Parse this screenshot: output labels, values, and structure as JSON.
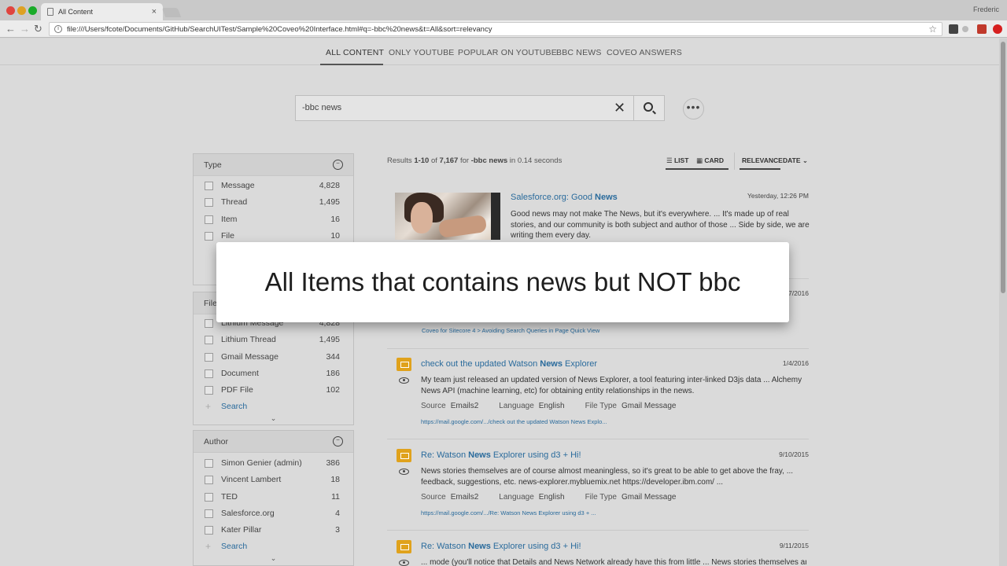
{
  "browser": {
    "tab_title": "All Content",
    "tab_close": "×",
    "profile": "Frederic",
    "url": "file:///Users/fcote/Documents/GitHub/SearchUITest/Sample%20Coveo%20Interface.html#q=-bbc%20news&t=All&sort=relevancy",
    "back": "←",
    "forward": "→",
    "reload": "↻",
    "star": "☆",
    "info": "i"
  },
  "tabs": [
    "ALL CONTENT",
    "ONLY YOUTUBE",
    "POPULAR ON YOUTUBE",
    "BBC NEWS",
    "COVEO ANSWERS"
  ],
  "search": {
    "query": "-bbc news",
    "clear": "✕",
    "more": "•••"
  },
  "facets": {
    "type": {
      "title": "Type",
      "options_icon": "−",
      "values": [
        {
          "label": "Message",
          "count": "4,828"
        },
        {
          "label": "Thread",
          "count": "1,495"
        },
        {
          "label": "Item",
          "count": "16"
        },
        {
          "label": "File",
          "count": "10"
        }
      ]
    },
    "filetype": {
      "title": "File Type",
      "values": [
        {
          "label": "Lithium Message",
          "count": "4,828"
        },
        {
          "label": "Lithium Thread",
          "count": "1,495"
        },
        {
          "label": "Gmail Message",
          "count": "344"
        },
        {
          "label": "Document",
          "count": "186"
        },
        {
          "label": "PDF File",
          "count": "102"
        }
      ],
      "search_label": "Search",
      "plus": "+",
      "chevron": "⌄"
    },
    "author": {
      "title": "Author",
      "options_icon": "−",
      "values": [
        {
          "label": "Simon Genier (admin)",
          "count": "386"
        },
        {
          "label": "Vincent Lambert",
          "count": "18"
        },
        {
          "label": "TED",
          "count": "11"
        },
        {
          "label": "Salesforce.org",
          "count": "4"
        },
        {
          "label": "Kater Pillar",
          "count": "3"
        }
      ],
      "search_label": "Search",
      "plus": "+",
      "chevron": "⌄"
    }
  },
  "summary": {
    "prefix": "Results ",
    "range": "1-10",
    "of": " of ",
    "total": "7,167",
    "for": " for ",
    "query": "-bbc news",
    "in": " in 0.14 seconds"
  },
  "views": {
    "list": "LIST",
    "card": "CARD",
    "relevance": "RELEVANCE",
    "date": "DATE"
  },
  "results": [
    {
      "title_a": "Salesforce.org: Good ",
      "title_b": "News",
      "date": "Yesterday, 12:26 PM",
      "excerpt": "Good news may not make The News, but it's everywhere. ... It's made up of real stories, and our community is both subject and author of those ... Side by side, we are writing them every day."
    },
    {
      "date": "7/2016",
      "uri": "Coveo for Sitecore 4 > Avoiding Search Queries in Page Quick View"
    },
    {
      "title_a": "check out the updated Watson ",
      "title_b": "News",
      "title_c": " Explorer",
      "date": "1/4/2016",
      "excerpt": "My team just released an updated version of News Explorer, a tool featuring inter-linked D3js data ... Alchemy News API (machine learning, etc) for obtaining entity relationships in the news.",
      "source_k": "Source",
      "source_v": "Emails2",
      "lang_k": "Language",
      "lang_v": "English",
      "ft_k": "File Type",
      "ft_v": "Gmail Message",
      "uri": "https://mail.google.com/.../check out the updated Watson News Explo..."
    },
    {
      "title_a": "Re: Watson ",
      "title_b": "News",
      "title_c": " Explorer using d3 + Hi!",
      "date": "9/10/2015",
      "excerpt": "News stories themselves are of course almost meaningless, so it's great to be able to get above the fray, ... feedback, suggestions, etc. news-explorer.mybluemix.net https://developer.ibm.com/ ...",
      "source_k": "Source",
      "source_v": "Emails2",
      "lang_k": "Language",
      "lang_v": "English",
      "ft_k": "File Type",
      "ft_v": "Gmail Message",
      "uri": "https://mail.google.com/.../Re: Watson News Explorer using d3 + ..."
    },
    {
      "title_a": "Re: Watson ",
      "title_b": "News",
      "title_c": " Explorer using d3 + Hi!",
      "date": "9/11/2015",
      "excerpt": "... mode (you'll notice that Details and News Network already have this from little ... News stories themselves are"
    }
  ],
  "callout": "All Items that contains news but NOT bbc",
  "colors": {
    "accent": "#2a6b9c",
    "mail": "#e0a21c"
  }
}
